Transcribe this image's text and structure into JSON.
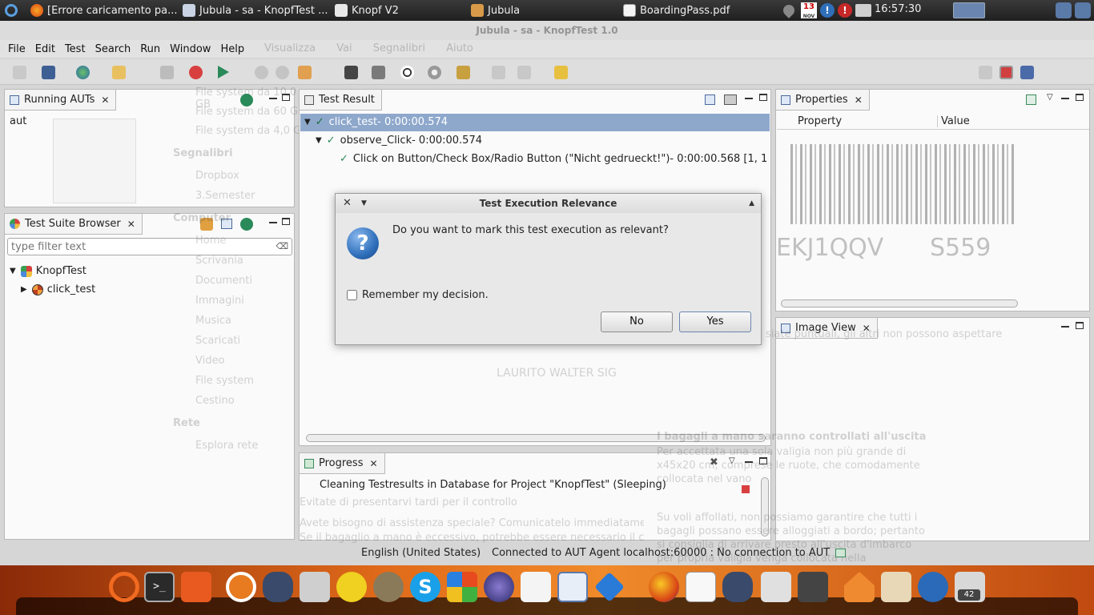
{
  "taskbar": {
    "tasks": [
      "[Errore caricamento pa...",
      "Jubula - sa - KnopfTest ...",
      "Knopf V2",
      "Jubula",
      "BoardingPass.pdf"
    ],
    "calendar_day": "13",
    "calendar_month": "NOV",
    "clock": "16:57:30"
  },
  "window": {
    "title": "Jubula - sa - KnopfTest 1.0"
  },
  "menubar": {
    "items": [
      "File",
      "Edit",
      "Test",
      "Search",
      "Run",
      "Window",
      "Help"
    ]
  },
  "ghost_menu": [
    "Visualizza",
    "Vai",
    "Segnalibri",
    "Aiuto"
  ],
  "ghost_sidebar": {
    "items": [
      "File system da 10,0 GB",
      "File system da 60 GB",
      "File system da 4,0 GB"
    ],
    "section_bookmarks": "Segnalibri",
    "bookmarks": [
      "Dropbox",
      "3.Semester"
    ],
    "section_computer": "Computer",
    "computer_items": [
      "Home",
      "Scrivania",
      "Documenti",
      "Immagini",
      "Musica",
      "Scaricati",
      "Video",
      "File system",
      "Cestino"
    ],
    "section_network": "Rete",
    "network_items": [
      "Esplora rete"
    ]
  },
  "ghost_pdf": {
    "code": "EKJ1QQV",
    "seat": "S559",
    "line1": "siate puntuali, gli altri non possono aspettare",
    "name": "LAURITO WALTER SIG",
    "para1": "I bagagli a mano saranno controllati all'uscita",
    "para2": "Per accettata una sola valigia non più grande di x45x20 cm, comprese le ruote, che comodamente collocata nel vano",
    "para3": "Su voli affollati, non possiamo garantire che tutti i bagagli possano essere alloggiati a bordo; pertanto si consiglia di arrivare presto all'uscita d'imbarco per propria valigia venga collocata nella",
    "bottom1": "Avete bisogno di assistenza speciale? Comunicatelo immediatamente",
    "bottom2": "Evitate di presentarvi tardi per il controllo",
    "bottom3": "Se il bagaglio a mano è eccessivo, potrebbe essere necessario il check-in"
  },
  "panels": {
    "running_auts": {
      "title": "Running AUTs",
      "items": [
        "aut"
      ]
    },
    "test_suite_browser": {
      "title": "Test Suite Browser",
      "filter_placeholder": "type filter text",
      "tree": {
        "root": "KnopfTest",
        "child": "click_test"
      }
    },
    "test_result": {
      "title": "Test Result",
      "rows": [
        {
          "name": "click_test",
          "time": " - 0:00:00.574"
        },
        {
          "name": "observe_Click",
          "time": " - 0:00:00.574"
        },
        {
          "name": "Click on Button/Check Box/Radio Button (\"Nicht gedrueckt!\")",
          "time": " - 0:00:00.568 [1, 1"
        }
      ]
    },
    "properties": {
      "title": "Properties",
      "col_property": "Property",
      "col_value": "Value"
    },
    "image_view": {
      "title": "Image View"
    },
    "progress": {
      "title": "Progress",
      "task": "Cleaning Testresults in Database for Project \"KnopfTest\" (Sleeping)"
    }
  },
  "dialog": {
    "title": "Test Execution Relevance",
    "question": "Do you want to mark this test execution as relevant?",
    "remember": "Remember my decision.",
    "remember_checked": false,
    "no_label": "No",
    "yes_label": "Yes"
  },
  "statusbar": {
    "language": "English (United States)",
    "connection": "Connected to AUT Agent localhost:60000 : No connection to AUT"
  },
  "dock": {
    "badge": "42"
  },
  "colors": {
    "selection": "#8ea8cc",
    "check": "#2a8a5a",
    "dock_orange": "#e06a1a",
    "question_blue": "#2f6fba"
  }
}
